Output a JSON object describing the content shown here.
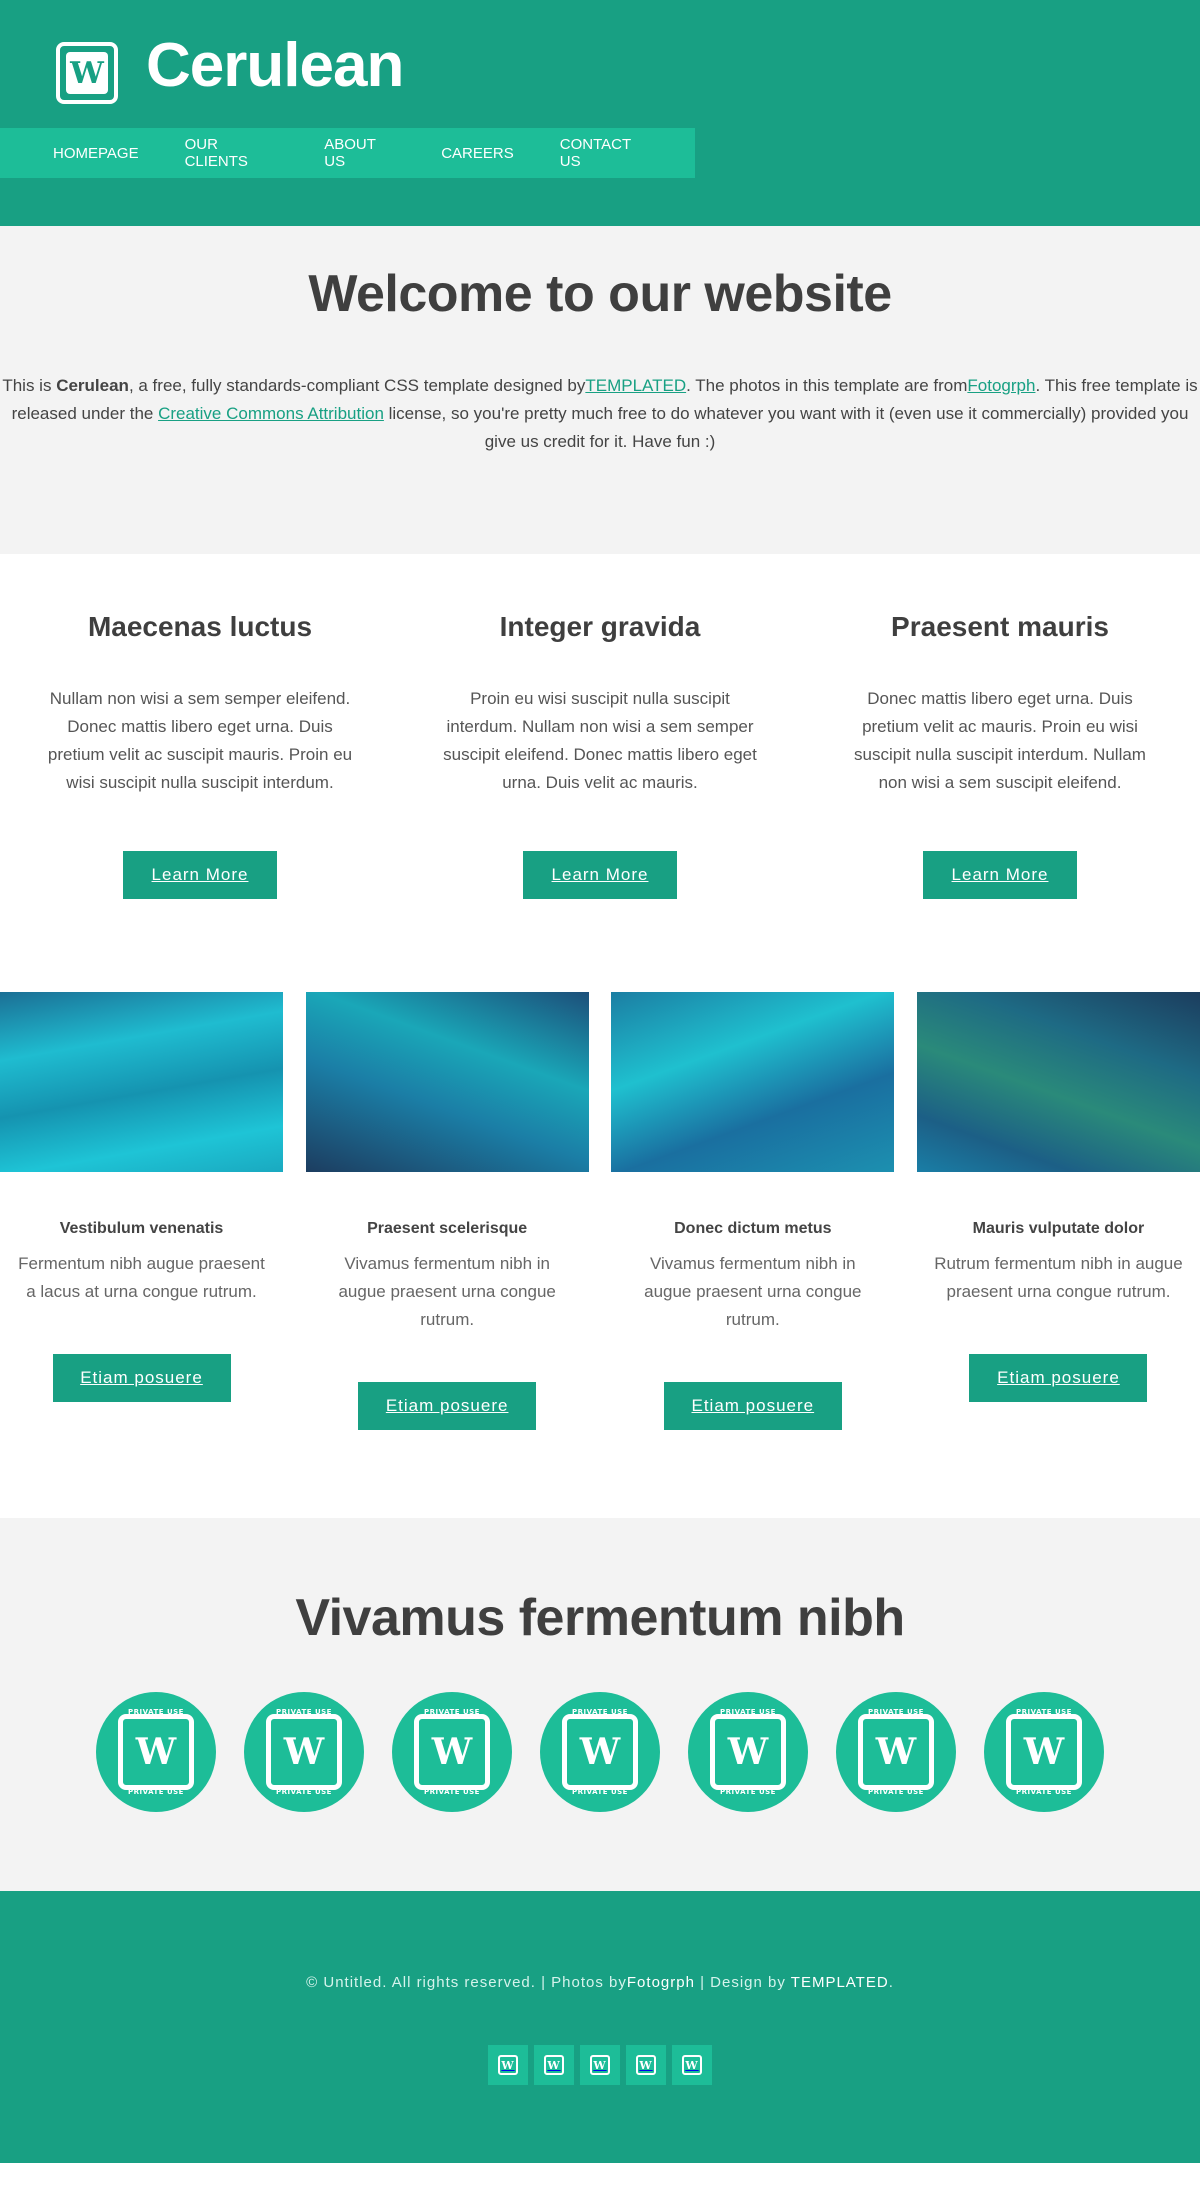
{
  "header": {
    "logo_glyph": "W",
    "title": "Cerulean",
    "nav": [
      "HOMEPAGE",
      "OUR CLIENTS",
      "ABOUT US",
      "CAREERS",
      "CONTACT US"
    ]
  },
  "welcome": {
    "title": "Welcome to our website",
    "p_before": "This is ",
    "p_bold": "Cerulean",
    "p_mid1": ", a free, fully standards-compliant CSS template designed by",
    "link_templated": "TEMPLATED",
    "p_mid2": ". The photos in this template are from",
    "link_fotogrph": "Fotogrph",
    "p_mid3": ". This free template is released under the ",
    "link_cc": "Creative Commons Attribution",
    "p_end": " license, so you're pretty much free to do whatever you want with it (even use it commercially) provided you give us credit for it. Have fun :)"
  },
  "features": [
    {
      "title": "Maecenas luctus",
      "text": "Nullam non wisi a sem semper eleifend. Donec mattis libero eget urna. Duis pretium velit ac suscipit mauris. Proin eu wisi suscipit nulla suscipit interdum.",
      "button": "Learn More"
    },
    {
      "title": "Integer gravida",
      "text": "Proin eu wisi suscipit nulla suscipit interdum. Nullam non wisi a sem semper suscipit eleifend. Donec mattis libero eget urna. Duis velit ac mauris.",
      "button": "Learn More"
    },
    {
      "title": "Praesent mauris",
      "text": "Donec mattis libero eget urna. Duis pretium velit ac mauris. Proin eu wisi suscipit nulla suscipit interdum. Nullam non wisi a sem suscipit eleifend.",
      "button": "Learn More"
    }
  ],
  "gallery": [
    {
      "title": "Vestibulum venenatis",
      "text": "Fermentum nibh augue praesent a lacus at urna congue rutrum.",
      "button": "Etiam posuere"
    },
    {
      "title": "Praesent scelerisque",
      "text": "Vivamus fermentum nibh in augue praesent urna congue rutrum.",
      "button": "Etiam posuere"
    },
    {
      "title": "Donec dictum metus",
      "text": "Vivamus fermentum nibh in augue praesent urna congue rutrum.",
      "button": "Etiam posuere"
    },
    {
      "title": "Mauris vulputate dolor",
      "text": "Rutrum fermentum nibh in augue praesent urna congue rutrum.",
      "button": "Etiam posuere"
    }
  ],
  "clients": {
    "title": "Vivamus fermentum nibh",
    "badge_glyph": "W",
    "badge_small_text": "PRIVATE USE",
    "count": 7
  },
  "footer": {
    "copy": "© Untitled. All rights reserved. | Photos by",
    "fotogrph": "Fotogrph",
    "design": " | Design by ",
    "templated": "TEMPLATED",
    "end": ".",
    "social_glyph": "W",
    "social_count": 5
  },
  "colors": {
    "primary": "#18a083",
    "accent": "#1dbd98",
    "light_bg": "#f3f3f3",
    "heading": "#3f3f3f"
  }
}
